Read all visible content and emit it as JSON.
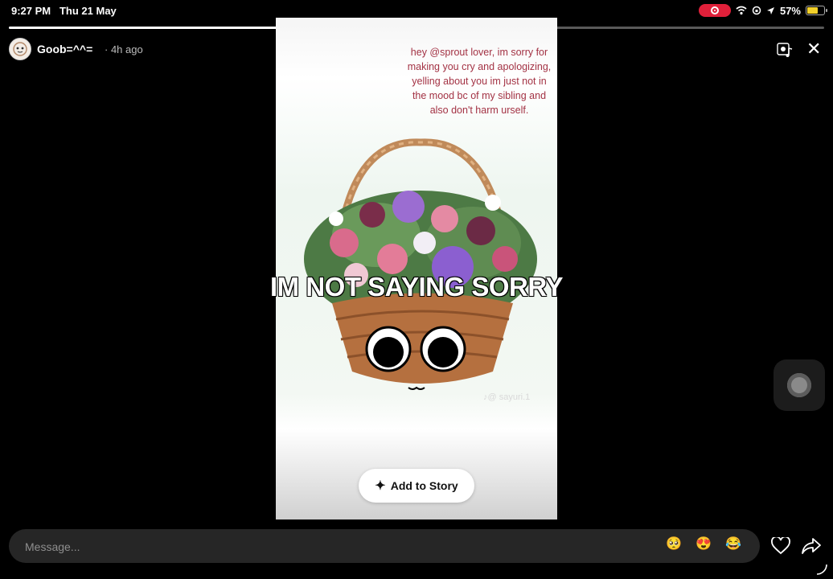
{
  "status": {
    "time": "9:27 PM",
    "date": "Thu 21 May",
    "battery": "57%",
    "battery_level": 0.57,
    "icons": [
      "screen-record-icon",
      "wifi-icon",
      "orientation-lock-icon",
      "location-icon",
      "battery-icon"
    ]
  },
  "story_progress": [
    1.0,
    1.0,
    0.0
  ],
  "header": {
    "username": "Goob=^^=",
    "posted": "· 4h ago"
  },
  "story": {
    "text": "hey @sprout lover, im sorry for making you cry and apologizing,  yelling about you im just not in the mood bc of my sibling and also don't harm urself.",
    "caption": "IM NOT SAYING SORRY",
    "watermark": "♪@ sayuri.1",
    "add_to_story": "Add to Story"
  },
  "message_bar": {
    "placeholder": "Message...",
    "quick_reactions": [
      "🥺",
      "😍",
      "😂"
    ]
  },
  "colors": {
    "story_text": "#a33244",
    "record_pill": "#e0203a",
    "battery_fill": "#f2d02a"
  }
}
